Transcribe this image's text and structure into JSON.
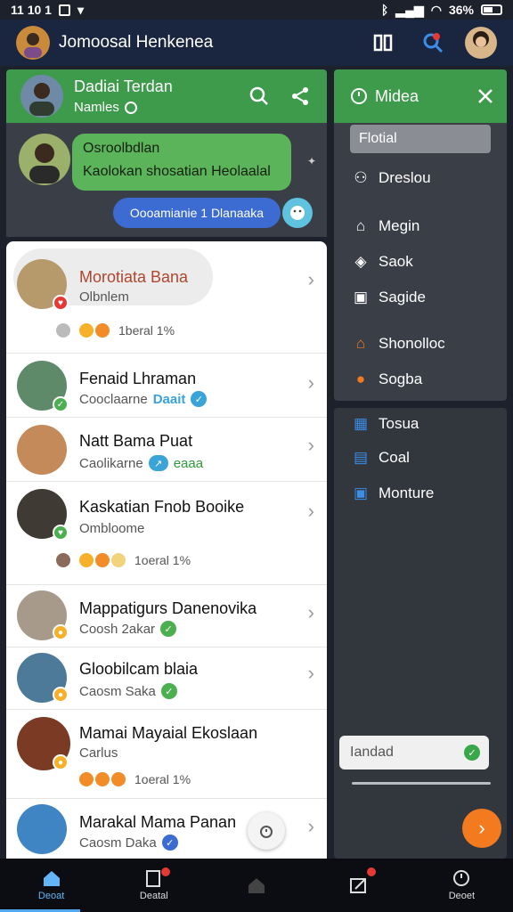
{
  "status_bar": {
    "time": "11 10 1",
    "battery": "36%"
  },
  "app_bar": {
    "title": "Jomoosal Henkenea"
  },
  "group_header": {
    "name": "Dadiai Terdan",
    "subtitle": "Namles"
  },
  "preview": {
    "bubble_line1": "Osroolbdlan",
    "bubble_line2": "Kaolokan shosatian Heolaalal",
    "blue_pill": "Oooamianie 1 Dlanaaka"
  },
  "chats": [
    {
      "name": "Morotiata Bana",
      "status": "Olbnlem",
      "reactions_text": "1beral 1%",
      "accent": "#e53935"
    },
    {
      "name": "Fenaid Lhraman",
      "status": "Cooclaarne",
      "status_tag": "Daait",
      "accent": "#4caf50"
    },
    {
      "name": "Natt Bama Puat",
      "status": "Caolikarne",
      "status_tag": "eaaa",
      "accent": "#4caf50"
    },
    {
      "name": "Kaskatian Fnob Booike",
      "status": "Ombloome",
      "reactions_text": "1oeral 1%",
      "accent": "#4caf50"
    },
    {
      "name": "Mappatigurs Danenovika",
      "status": "Coosh 2akar",
      "accent": "#f6b02a"
    },
    {
      "name": "Gloobilcam blaia",
      "status": "Caosm Saka",
      "accent": "#f6b02a"
    },
    {
      "name": "Mamai Mayaial Ekoslaan",
      "status": "Carlus",
      "reactions_text": "1oeral 1%",
      "accent": "#f6b02a"
    },
    {
      "name": "Marakal Mama Panan",
      "status": "Caosm Daka",
      "accent": "#3c6bd1"
    }
  ],
  "drawer": {
    "title": "Midea",
    "selected": "Flotial",
    "items": [
      "Dreslou",
      "Megin",
      "Saok",
      "Sagide",
      "Shonolloc",
      "Sogba"
    ],
    "lower_items": [
      "Tosua",
      "Coal",
      "Monture"
    ],
    "input_value": "Iandad"
  },
  "bottom_nav": [
    "Deoat",
    "Deatal",
    "",
    "",
    "Deoet"
  ],
  "colors": {
    "green": "#3f9b4c",
    "bar": "#1a2540",
    "accent_orange": "#f37a1f"
  }
}
